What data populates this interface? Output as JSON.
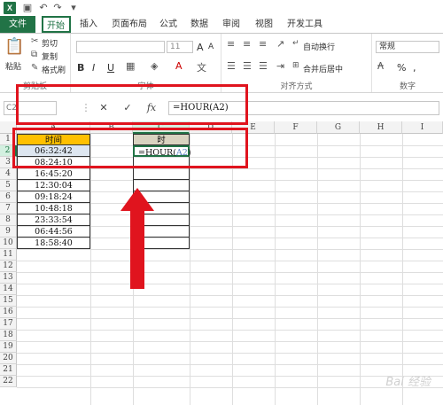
{
  "title_bar": {
    "app_icon": "X",
    "icons": [
      "excel-logo-icon",
      "save-icon",
      "undo-icon",
      "redo-icon",
      "customize-icon"
    ]
  },
  "tabs": [
    {
      "label": "文件"
    },
    {
      "label": "开始"
    },
    {
      "label": "插入"
    },
    {
      "label": "页面布局"
    },
    {
      "label": "公式"
    },
    {
      "label": "数据"
    },
    {
      "label": "审阅"
    },
    {
      "label": "视图"
    },
    {
      "label": "开发工具"
    }
  ],
  "ribbon": {
    "clipboard": {
      "cut": "剪切",
      "copy": "复制",
      "format_painter": "格式刷",
      "paste": "粘贴",
      "group_label": "剪贴板"
    },
    "font": {
      "size": "11",
      "group_label": "字体",
      "bold": "B",
      "italic": "I",
      "underline": "U"
    },
    "alignment": {
      "wrap_text": "自动换行",
      "merge_center": "合并后居中",
      "group_label": "对齐方式"
    },
    "number": {
      "format": "常规",
      "group_label": "数字",
      "percent": "%",
      "comma": ","
    }
  },
  "formula_bar": {
    "name_box": "C2",
    "formula": "=HOUR(A2)"
  },
  "columns": [
    "A",
    "B",
    "C",
    "D",
    "E",
    "F",
    "G",
    "H",
    "I"
  ],
  "rows": [
    "1",
    "2",
    "3",
    "4",
    "5",
    "6",
    "7",
    "8",
    "9",
    "10",
    "11",
    "12",
    "13",
    "14",
    "15",
    "16",
    "17",
    "18",
    "19",
    "20",
    "21",
    "22"
  ],
  "sheet": {
    "a_header": "时间",
    "c_header": "时",
    "a_values": [
      "06:32:42",
      "08:24:10",
      "16:45:20",
      "12:30:04",
      "09:18:24",
      "10:48:18",
      "23:33:54",
      "06:44:56",
      "18:58:40"
    ],
    "c2_func": "=HOUR(",
    "c2_ref": "A2",
    "c2_close": ")"
  },
  "watermark": "Bai 经验",
  "colors": {
    "excel_green": "#217346",
    "header_a": "#ffc000",
    "header_c": "#d9d3c0",
    "annotation_red": "#e0141e"
  }
}
